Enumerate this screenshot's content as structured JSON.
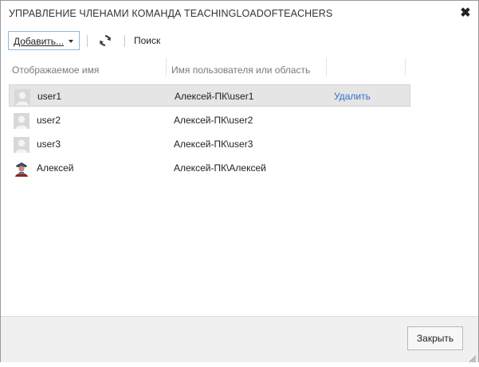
{
  "dialog": {
    "title": "УПРАВЛЕНИЕ ЧЛЕНАМИ КОМАНДА TEACHINGLOADOFTEACHERS",
    "close_glyph": "✖"
  },
  "toolbar": {
    "add_label": "Добавить...",
    "refresh_icon": "refresh-icon",
    "search_label": "Поиск"
  },
  "columns": {
    "display_name": "Отображаемое имя",
    "user_or_scope": "Имя пользователя или область"
  },
  "members": [
    {
      "name": "user1",
      "account": "Алексей-ПК\\user1",
      "action": "Удалить",
      "avatar": "default-user-avatar",
      "selected": true
    },
    {
      "name": "user2",
      "account": "Алексей-ПК\\user2",
      "action": "",
      "avatar": "default-user-avatar",
      "selected": false
    },
    {
      "name": "user3",
      "account": "Алексей-ПК\\user3",
      "action": "",
      "avatar": "default-user-avatar",
      "selected": false
    },
    {
      "name": "Алексей",
      "account": "Алексей-ПК\\Алексей",
      "action": "",
      "avatar": "photo-avatar",
      "selected": false
    }
  ],
  "footer": {
    "close_label": "Закрыть"
  },
  "colors": {
    "link": "#2f6fc7",
    "selected_row": "#e5e5e5",
    "header_text": "#7a7a7a"
  }
}
